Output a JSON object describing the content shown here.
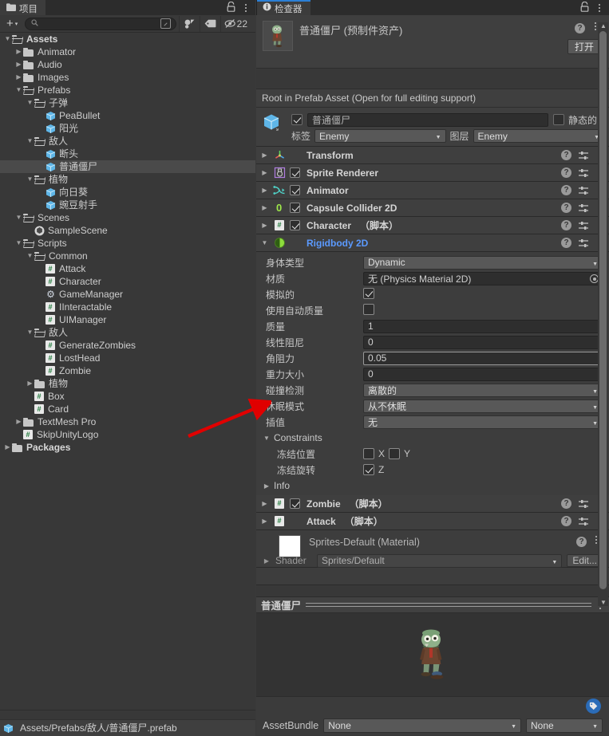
{
  "project": {
    "tab_label": "项目",
    "tab_icon": "folder-icon",
    "lock_icon": "lock-icon",
    "menu_icon": "kebab-menu-icon",
    "toolbar": {
      "add_label": "+",
      "add_caret": "▾",
      "search_placeholder": "",
      "search_value": "",
      "search_icon": "search-icon",
      "save_search_icon": "save-search-icon",
      "favorites_icon": "asset-filter-icon",
      "label_icon": "label-tag-icon",
      "hidden_icon": "hidden-packages-icon",
      "hidden_count": "22"
    },
    "tree": [
      {
        "label": "Assets",
        "depth": 0,
        "arrow": "▼",
        "icon": "folder-open-icon",
        "bold": true
      },
      {
        "label": "Animator",
        "depth": 1,
        "arrow": "▶",
        "icon": "folder-icon",
        "bold": false
      },
      {
        "label": "Audio",
        "depth": 1,
        "arrow": "▶",
        "icon": "folder-icon",
        "bold": false
      },
      {
        "label": "Images",
        "depth": 1,
        "arrow": "▶",
        "icon": "folder-icon",
        "bold": false
      },
      {
        "label": "Prefabs",
        "depth": 1,
        "arrow": "▼",
        "icon": "folder-open-icon",
        "bold": false
      },
      {
        "label": "子弹",
        "depth": 2,
        "arrow": "▼",
        "icon": "folder-open-icon",
        "bold": false
      },
      {
        "label": "PeaBullet",
        "depth": 3,
        "arrow": "",
        "icon": "prefab-cube-icon",
        "bold": false
      },
      {
        "label": "阳光",
        "depth": 3,
        "arrow": "",
        "icon": "prefab-cube-icon",
        "bold": false
      },
      {
        "label": "敌人",
        "depth": 2,
        "arrow": "▼",
        "icon": "folder-open-icon",
        "bold": false
      },
      {
        "label": "断头",
        "depth": 3,
        "arrow": "",
        "icon": "prefab-cube-icon",
        "bold": false
      },
      {
        "label": "普通僵尸",
        "depth": 3,
        "arrow": "",
        "icon": "prefab-cube-icon",
        "bold": false,
        "selected": true
      },
      {
        "label": "植物",
        "depth": 2,
        "arrow": "▼",
        "icon": "folder-open-icon",
        "bold": false
      },
      {
        "label": "向日葵",
        "depth": 3,
        "arrow": "",
        "icon": "prefab-cube-icon",
        "bold": false
      },
      {
        "label": "豌豆射手",
        "depth": 3,
        "arrow": "",
        "icon": "prefab-cube-icon",
        "bold": false
      },
      {
        "label": "Scenes",
        "depth": 1,
        "arrow": "▼",
        "icon": "folder-open-icon",
        "bold": false
      },
      {
        "label": "SampleScene",
        "depth": 2,
        "arrow": "",
        "icon": "unity-scene-icon",
        "bold": false
      },
      {
        "label": "Scripts",
        "depth": 1,
        "arrow": "▼",
        "icon": "folder-open-icon",
        "bold": false
      },
      {
        "label": "Common",
        "depth": 2,
        "arrow": "▼",
        "icon": "folder-open-icon",
        "bold": false
      },
      {
        "label": "Attack",
        "depth": 3,
        "arrow": "",
        "icon": "csharp-script-icon",
        "bold": false
      },
      {
        "label": "Character",
        "depth": 3,
        "arrow": "",
        "icon": "csharp-script-icon",
        "bold": false
      },
      {
        "label": "GameManager",
        "depth": 3,
        "arrow": "",
        "icon": "gear-icon",
        "bold": false
      },
      {
        "label": "IInteractable",
        "depth": 3,
        "arrow": "",
        "icon": "csharp-script-icon",
        "bold": false
      },
      {
        "label": "UIManager",
        "depth": 3,
        "arrow": "",
        "icon": "csharp-script-icon",
        "bold": false
      },
      {
        "label": "敌人",
        "depth": 2,
        "arrow": "▼",
        "icon": "folder-open-icon",
        "bold": false
      },
      {
        "label": "GenerateZombies",
        "depth": 3,
        "arrow": "",
        "icon": "csharp-script-icon",
        "bold": false
      },
      {
        "label": "LostHead",
        "depth": 3,
        "arrow": "",
        "icon": "csharp-script-icon",
        "bold": false
      },
      {
        "label": "Zombie",
        "depth": 3,
        "arrow": "",
        "icon": "csharp-script-icon",
        "bold": false
      },
      {
        "label": "植物",
        "depth": 2,
        "arrow": "▶",
        "icon": "folder-icon",
        "bold": false
      },
      {
        "label": "Box",
        "depth": 2,
        "arrow": "",
        "icon": "csharp-script-icon",
        "bold": false
      },
      {
        "label": "Card",
        "depth": 2,
        "arrow": "",
        "icon": "csharp-script-icon",
        "bold": false
      },
      {
        "label": "TextMesh Pro",
        "depth": 1,
        "arrow": "▶",
        "icon": "folder-icon",
        "bold": false
      },
      {
        "label": "SkipUnityLogo",
        "depth": 1,
        "arrow": "",
        "icon": "csharp-script-icon",
        "bold": false
      },
      {
        "label": "Packages",
        "depth": 0,
        "arrow": "▶",
        "icon": "folder-icon",
        "bold": true
      }
    ],
    "status_path": "Assets/Prefabs/敌人/普通僵尸.prefab",
    "status_icon": "prefab-cube-icon"
  },
  "inspector": {
    "tab_label": "检查器",
    "tab_icon": "info-icon",
    "lock_icon": "lock-icon",
    "menu_icon": "kebab-menu-icon",
    "asset": {
      "title": "普通僵尸 (预制件资产)",
      "thumb_icon": "zombie-sprite-thumb",
      "help_icon": "help-icon",
      "kebab_icon": "kebab-menu-icon",
      "open_button": "打开"
    },
    "prefab_note": "Root in Prefab Asset (Open for full editing support)",
    "gameobject": {
      "icon": "gameobject-cube-icon",
      "enabled": true,
      "name": "普通僵尸",
      "static_checked": false,
      "static_label": "静态的",
      "static_caret": "▾",
      "tag_label": "标签",
      "tag_value": "Enemy",
      "layer_label": "图层",
      "layer_value": "Enemy"
    },
    "components": [
      {
        "name": "Transform",
        "suffix": "",
        "icon": "transform-axis-icon",
        "arrow": "▶",
        "has_toggle": false,
        "enabled": false,
        "highlight": false
      },
      {
        "name": "Sprite Renderer",
        "suffix": "",
        "icon": "sprite-renderer-icon",
        "arrow": "▶",
        "has_toggle": true,
        "enabled": true,
        "highlight": false
      },
      {
        "name": "Animator",
        "suffix": "",
        "icon": "animator-icon",
        "arrow": "▶",
        "has_toggle": true,
        "enabled": true,
        "highlight": false
      },
      {
        "name": "Capsule Collider 2D",
        "suffix": "",
        "icon": "capsule-collider-2d-icon",
        "arrow": "▶",
        "has_toggle": true,
        "enabled": true,
        "highlight": false
      },
      {
        "name": "Character",
        "suffix": "（脚本）",
        "icon": "csharp-script-icon",
        "arrow": "▶",
        "has_toggle": true,
        "enabled": true,
        "highlight": false
      },
      {
        "name": "Rigidbody 2D",
        "suffix": "",
        "icon": "rigidbody-2d-icon",
        "arrow": "▼",
        "has_toggle": false,
        "enabled": false,
        "highlight": true
      }
    ],
    "rigidbody": {
      "body_type_label": "身体类型",
      "body_type_value": "Dynamic",
      "material_label": "材质",
      "material_value": "无 (Physics Material 2D)",
      "simulated_label": "模拟的",
      "simulated_checked": true,
      "auto_mass_label": "使用自动质量",
      "auto_mass_checked": false,
      "mass_label": "质量",
      "mass_value": "1",
      "linear_drag_label": "线性阻尼",
      "linear_drag_value": "0",
      "angular_drag_label": "角阻力",
      "angular_drag_value": "0.05",
      "gravity_label": "重力大小",
      "gravity_value": "0",
      "collision_label": "碰撞检测",
      "collision_value": "离散的",
      "sleep_label": "休眠模式",
      "sleep_value": "从不休眠",
      "interpolate_label": "插值",
      "interpolate_value": "无",
      "constraints_label": "Constraints",
      "constraints_arrow": "▼",
      "freeze_pos_label": "冻结位置",
      "freeze_pos_x_label": "X",
      "freeze_pos_x": false,
      "freeze_pos_y_label": "Y",
      "freeze_pos_y": false,
      "freeze_rot_label": "冻结旋转",
      "freeze_rot_z_label": "Z",
      "freeze_rot_z": true,
      "info_label": "Info",
      "info_arrow": "▶"
    },
    "lower_components": [
      {
        "name": "Zombie",
        "suffix": "（脚本）",
        "icon": "csharp-script-icon",
        "arrow": "▶",
        "has_toggle": true,
        "enabled": true
      },
      {
        "name": "Attack",
        "suffix": "（脚本）",
        "icon": "csharp-script-icon",
        "arrow": "▶",
        "has_toggle": false,
        "enabled": false
      }
    ],
    "material": {
      "name": "Sprites-Default (Material)",
      "swatch_color": "#ffffff",
      "shader_label": "Shader",
      "shader_value": "Sprites/Default",
      "edit_button": "Edit...",
      "help_icon": "help-icon",
      "kebab_icon": "kebab-menu-icon",
      "arrow": "▶"
    },
    "preview": {
      "title": "普通僵尸",
      "kebab_icon": "kebab-menu-icon",
      "sprite_icon": "zombie-sprite-preview"
    },
    "assetbundle": {
      "label": "AssetBundle",
      "name_value": "None",
      "variant_value": "None",
      "tag_badge_icon": "asset-label-icon"
    }
  },
  "colors": {
    "panel_bg": "#383838",
    "header_bg": "#3f3f3f",
    "accent_blue": "#2b7fd6",
    "component_blue": "#5b9aff",
    "dropdown_bg": "#585858",
    "field_bg": "#2e2e2e",
    "annotation_red": "#e00000",
    "selection_gray": "#4a4a4a"
  },
  "annotation": {
    "arrow_icon": "red-pointer-arrow",
    "color": "#e00000"
  }
}
